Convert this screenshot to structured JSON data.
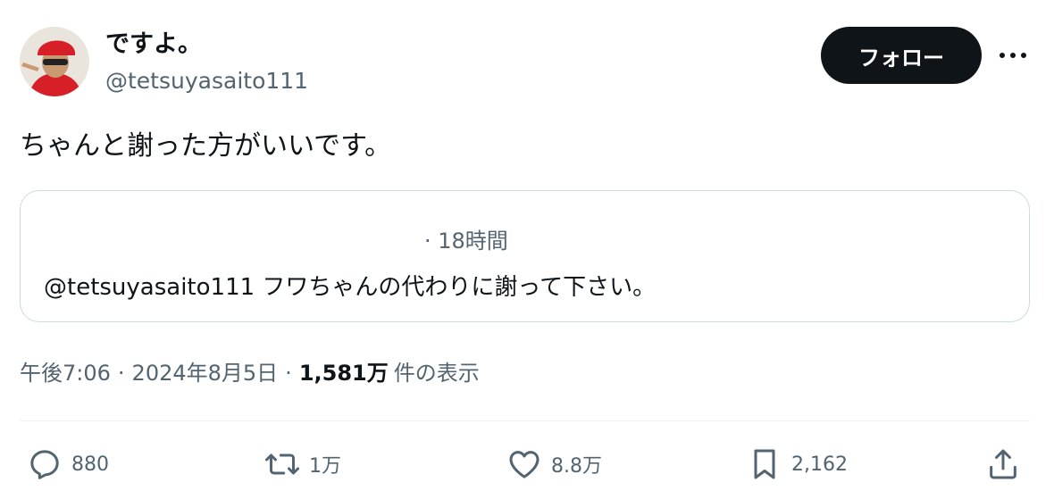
{
  "author": {
    "display_name": "ですよ。",
    "handle": "@tetsuyasaito111"
  },
  "follow_label": "フォロー",
  "more_icon": "more-horizontal-icon",
  "tweet": {
    "text": "ちゃんと謝った方がいいです。"
  },
  "quote": {
    "time": "· 18時間",
    "text": "@tetsuyasaito111 フワちゃんの代わりに謝って下さい。"
  },
  "meta": {
    "time": "午後7:06",
    "separator": "·",
    "date": "2024年8月5日",
    "views_count": "1,581万",
    "views_label": "件の表示"
  },
  "actions": {
    "reply": {
      "icon": "reply-icon",
      "count": "880"
    },
    "retweet": {
      "icon": "retweet-icon",
      "count": "1万"
    },
    "like": {
      "icon": "heart-icon",
      "count": "8.8万"
    },
    "bookmark": {
      "icon": "bookmark-icon",
      "count": "2,162"
    },
    "share": {
      "icon": "share-icon"
    }
  },
  "colors": {
    "text_primary": "#0f1419",
    "text_secondary": "#536471",
    "border": "#cfd9de",
    "follow_bg": "#0f1419",
    "follow_text": "#ffffff"
  }
}
